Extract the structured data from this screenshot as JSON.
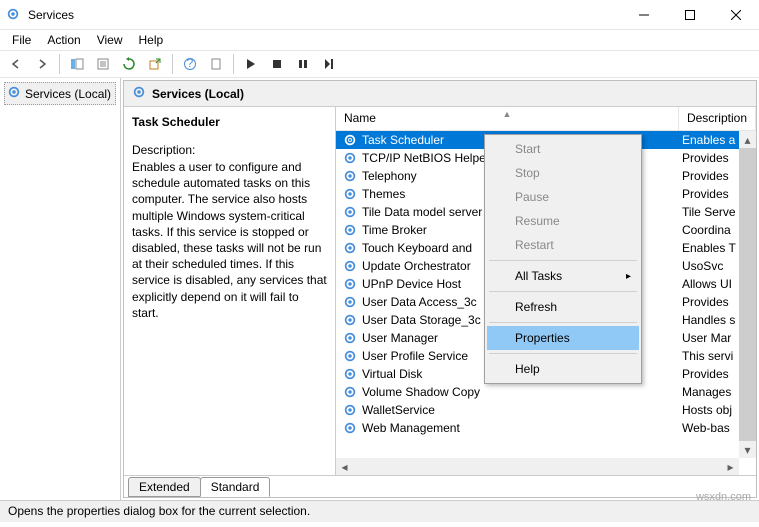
{
  "window": {
    "title": "Services"
  },
  "menubar": [
    "File",
    "Action",
    "View",
    "Help"
  ],
  "leftPane": {
    "label": "Services (Local)"
  },
  "rightHeader": {
    "title": "Services (Local)"
  },
  "detail": {
    "selectedName": "Task Scheduler",
    "descLabel": "Description:",
    "descText": "Enables a user to configure and schedule automated tasks on this computer. The service also hosts multiple Windows system-critical tasks. If this service is stopped or disabled, these tasks will not be run at their scheduled times. If this service is disabled, any services that explicitly depend on it will fail to start."
  },
  "columns": {
    "name": "Name",
    "desc": "Description"
  },
  "services": [
    {
      "name": "Task Scheduler",
      "desc": "Enables a",
      "selected": true
    },
    {
      "name": "TCP/IP NetBIOS Helper",
      "desc": "Provides"
    },
    {
      "name": "Telephony",
      "desc": "Provides"
    },
    {
      "name": "Themes",
      "desc": "Provides"
    },
    {
      "name": "Tile Data model server",
      "desc": "Tile Serve"
    },
    {
      "name": "Time Broker",
      "desc": "Coordina"
    },
    {
      "name": "Touch Keyboard and",
      "desc": "Enables T"
    },
    {
      "name": "Update Orchestrator",
      "desc": "UsoSvc"
    },
    {
      "name": "UPnP Device Host",
      "desc": "Allows UI"
    },
    {
      "name": "User Data Access_3c",
      "desc": "Provides"
    },
    {
      "name": "User Data Storage_3c",
      "desc": "Handles s"
    },
    {
      "name": "User Manager",
      "desc": "User Mar"
    },
    {
      "name": "User Profile Service",
      "desc": "This servi"
    },
    {
      "name": "Virtual Disk",
      "desc": "Provides"
    },
    {
      "name": "Volume Shadow Copy",
      "desc": "Manages"
    },
    {
      "name": "WalletService",
      "desc": "Hosts obj"
    },
    {
      "name": "Web Management",
      "desc": "Web-bas"
    }
  ],
  "tabs": {
    "extended": "Extended",
    "standard": "Standard"
  },
  "statusbar": "Opens the properties dialog box for the current selection.",
  "watermark": "wsxdn.com",
  "contextMenu": {
    "start": "Start",
    "stop": "Stop",
    "pause": "Pause",
    "resume": "Resume",
    "restart": "Restart",
    "allTasks": "All Tasks",
    "refresh": "Refresh",
    "properties": "Properties",
    "help": "Help"
  }
}
